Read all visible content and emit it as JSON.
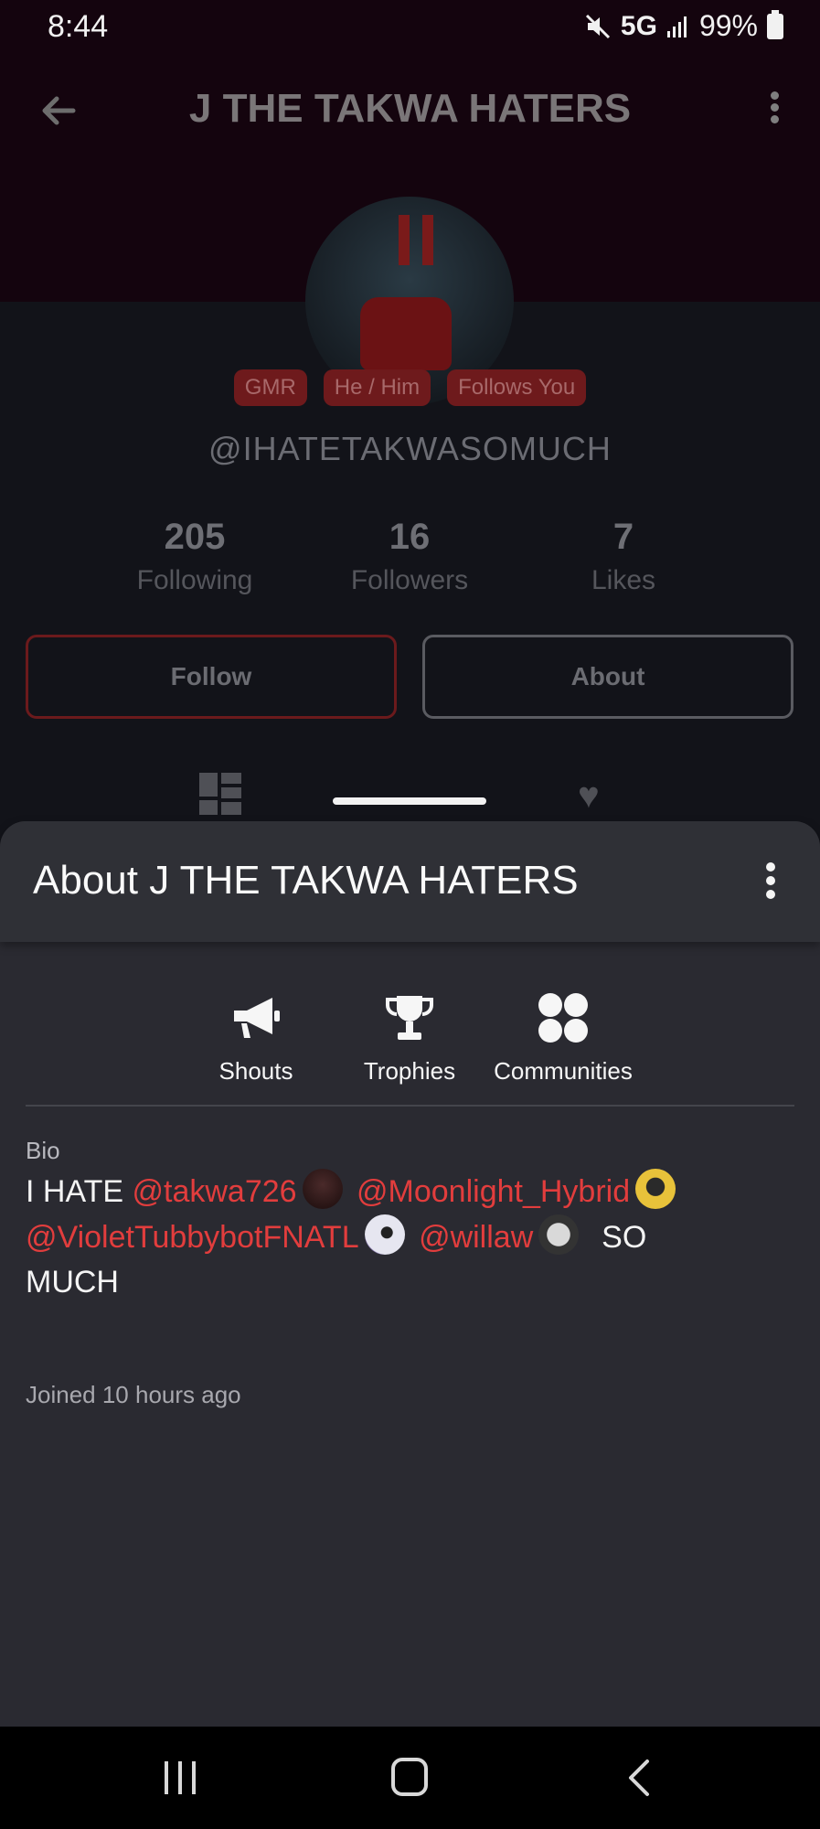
{
  "status_bar": {
    "time": "8:44",
    "network": "5G",
    "battery": "99%"
  },
  "appbar": {
    "title": "J THE TAKWA HATERS"
  },
  "profile": {
    "badges": [
      "GMR",
      "He / Him",
      "Follows You"
    ],
    "handle": "@IHATETAKWASOMUCH",
    "stats": [
      {
        "value": "205",
        "label": "Following"
      },
      {
        "value": "16",
        "label": "Followers"
      },
      {
        "value": "7",
        "label": "Likes"
      }
    ],
    "follow_label": "Follow",
    "about_label": "About"
  },
  "sheet": {
    "title": "About J THE TAKWA HATERS",
    "tabs": [
      {
        "label": "Shouts",
        "icon": "megaphone-icon"
      },
      {
        "label": "Trophies",
        "icon": "trophy-icon"
      },
      {
        "label": "Communities",
        "icon": "communities-icon"
      }
    ],
    "bio_label": "Bio",
    "bio": {
      "prefix": "I HATE",
      "mentions": [
        "@takwa726",
        "@Moonlight_Hybrid",
        "@VioletTubbybotFNATL",
        "@willaw"
      ],
      "suffix_1": "SO",
      "suffix_2": "MUCH"
    },
    "joined": "Joined 10 hours ago"
  },
  "colors": {
    "accent": "#e23d3d",
    "sheet_bg": "#2a2a31",
    "header_bg": "#14040e"
  }
}
